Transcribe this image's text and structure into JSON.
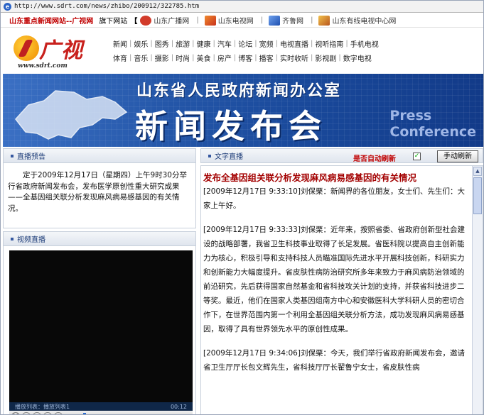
{
  "address_bar": {
    "url": "http://www.sdrt.com/news/zhibo/200912/322785.htm"
  },
  "top_links": {
    "site_title": "山东重点新闻网站--广视网",
    "sub_label": "旗下网站",
    "bracket": "【",
    "networks": [
      {
        "icon": "radio-station-icon",
        "label": "山东广播网",
        "color": "#d23b2a"
      },
      {
        "icon": "tv-station-icon",
        "label": "山东电视网",
        "color": "#e0552e"
      },
      {
        "icon": "qilu-icon",
        "label": "齐鲁网",
        "color": "#2a62c4"
      },
      {
        "icon": "cable-tv-icon",
        "label": "山东有线电视中心网",
        "color": "#b8561d"
      }
    ],
    "separator": "|"
  },
  "logo": {
    "text": "广视",
    "url": "www.sdrt.com"
  },
  "nav": {
    "row1": [
      "新闻",
      "娱乐",
      "图秀",
      "旅游",
      "健康",
      "汽车",
      "论坛",
      "宽频",
      "电视直播",
      "视听指南",
      "手机电视"
    ],
    "row2": [
      "体育",
      "音乐",
      "摄影",
      "时尚",
      "美食",
      "房产",
      "博客",
      "播客",
      "实时收听",
      "影视剧",
      "数字电视"
    ]
  },
  "banner": {
    "line1": "山东省人民政府新闻办公室",
    "line2": "新闻发布会",
    "press1": "Press",
    "press2": "Conference"
  },
  "preview": {
    "title": "直播预告",
    "text": "定于2009年12月17日（星期四）上午9时30分举行省政府新闻发布会，发布医学原创性重大研究成果——全基因组关联分析发现麻风病易感基因的有关情况。"
  },
  "video": {
    "title": "视频直播",
    "playlist_label": "播放列表：播放列表1",
    "time": "00:12"
  },
  "text_live": {
    "title": "文字直播",
    "auto_refresh_label": "是否自动刷新",
    "auto_refresh_checked": "✓",
    "refresh_button": "手动刷新",
    "headline": "发布全基因组关联分析发现麻风病易感基因的有关情况",
    "entries": [
      {
        "time": "[2009年12月17日 9:33:10]",
        "text": "刘保栗：新闻界的各位朋友，女士们、先生们：大家上午好。"
      },
      {
        "time": "[2009年12月17日 9:33:33]",
        "text": "刘保栗：近年来，按照省委、省政府创新型社会建设的战略部署，我省卫生科技事业取得了长足发展。省医科院以提高自主创新能力为核心，积极引导和支持科技人员瞄准国际先进水平开展科技创新，科研实力和创新能力大幅度提升。省皮肤性病防治研究所多年来致力于麻风病防治领域的前沿研究，先后获得国家自然基金和省科技攻关计划的支持，并获省科技进步二等奖。最近，他们在国家人类基因组南方中心和安徽医科大学科研人员的密切合作下，在世界范围内第一个利用全基因组关联分析方法，成功发现麻风病易感基因，取得了具有世界领先水平的原创性成果。"
      },
      {
        "time": "[2009年12月17日 9:34:06]",
        "text": "刘保栗：今天，我们举行省政府新闻发布会，邀请省卫生厅厅长包文辉先生，省科技厅厅长翟鲁宁女士，省皮肤性病"
      }
    ]
  },
  "colors": {
    "brand_red": "#c00000",
    "headline_red": "#a30000",
    "banner_blue": "#1a4a9c",
    "panel_title_blue": "#1d3c78"
  }
}
